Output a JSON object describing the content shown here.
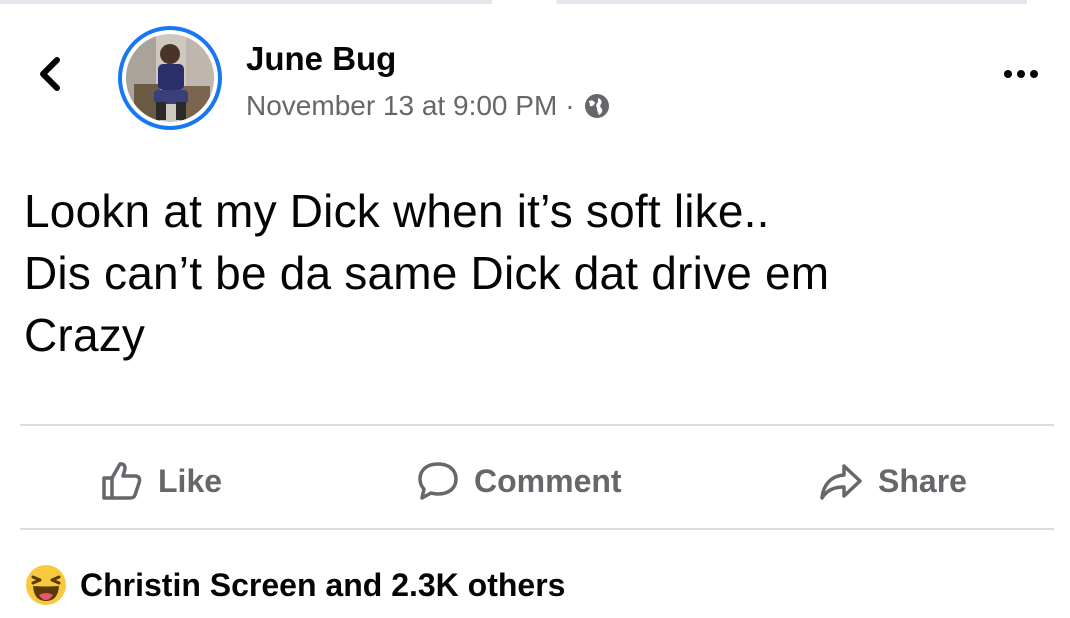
{
  "post": {
    "author": "June Bug",
    "timestamp": "November 13 at 9:00 PM",
    "separator": "·",
    "privacy_icon": "globe-icon",
    "text_lines": [
      "Lookn at my Dick when it’s soft like..",
      "Dis can’t be da same Dick dat drive em",
      "Crazy"
    ]
  },
  "actions": {
    "like_label": "Like",
    "comment_label": "Comment",
    "share_label": "Share"
  },
  "reactions": {
    "icon": "haha-reaction-icon",
    "summary": "Christin Screen and 2.3K others"
  },
  "colors": {
    "avatar_ring": "#1877f2",
    "secondary_text": "#65676b",
    "haha_yellow": "#f7c93e"
  }
}
